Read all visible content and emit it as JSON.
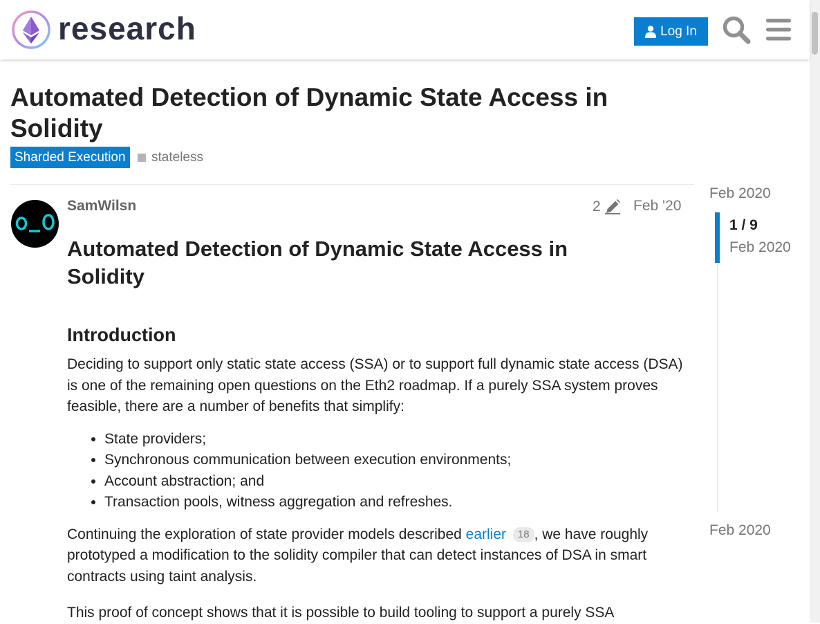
{
  "header": {
    "logo_text": "research",
    "login_label": "Log In",
    "search_icon": "search-icon",
    "menu_icon": "hamburger-menu-icon",
    "accent_color": "#0a7fd0"
  },
  "topic": {
    "title": "Automated Detection of Dynamic State Access in Solidity",
    "category": "Sharded Execution",
    "tag": "stateless"
  },
  "post": {
    "username": "SamWilsn",
    "edit_count": "2",
    "date": "Feb '20",
    "heading": "Automated Detection of Dynamic State Access in Solidity",
    "section_heading": "Introduction",
    "intro_paragraph": "Deciding to support only static state access (SSA) or to support full dynamic state access (DSA) is one of the remaining open questions on the Eth2 roadmap. If a purely SSA system proves feasible, there are a number of benefits that simplify:",
    "list_items": [
      "State providers;",
      "Synchronous communication between execution environments;",
      "Account abstraction; and",
      "Transaction pools, witness aggregation and refreshes."
    ],
    "para2_before_link": "Continuing the exploration of state provider models described ",
    "para2_link": "earlier",
    "para2_link_clicks": "18",
    "para2_after_link": ", we have roughly prototyped a modification to the solidity compiler that can detect instances of DSA in smart contracts using taint analysis.",
    "para3_partial": "This proof of concept shows that it is possible to build tooling to support a purely SSA"
  },
  "timeline": {
    "start_date": "Feb 2020",
    "position": "1 / 9",
    "handle_date": "Feb 2020",
    "end_date": "Feb 2020"
  }
}
